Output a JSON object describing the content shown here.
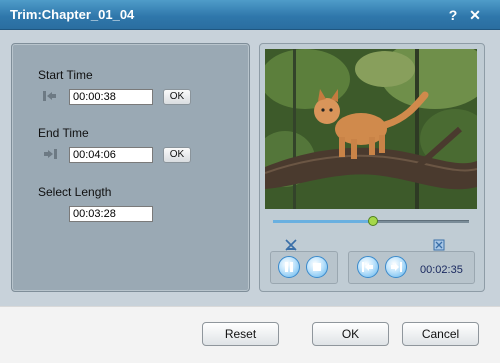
{
  "window": {
    "title": "Trim:Chapter_01_04",
    "help": "?",
    "close": "✕"
  },
  "trim": {
    "start": {
      "label": "Start Time",
      "value": "00:00:38",
      "ok": "OK"
    },
    "end": {
      "label": "End Time",
      "value": "00:04:06",
      "ok": "OK"
    },
    "length": {
      "label": "Select Length",
      "value": "00:03:28"
    }
  },
  "player": {
    "elapsed": "00:02:35",
    "position_fraction": 0.51
  },
  "footer": {
    "reset": "Reset",
    "ok": "OK",
    "cancel": "Cancel"
  }
}
